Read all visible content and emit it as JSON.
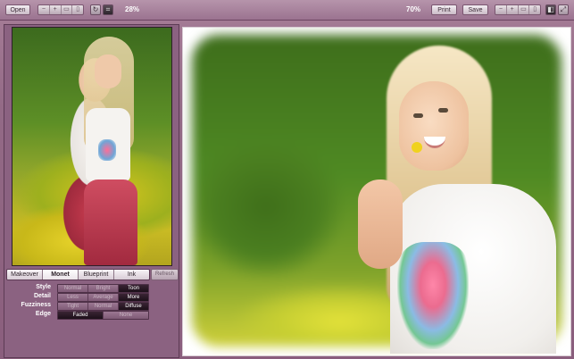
{
  "toolbar": {
    "open_label": "Open",
    "left_zoom_value": "28%",
    "right_zoom_value": "70%",
    "print_label": "Print",
    "save_label": "Save"
  },
  "tabs": [
    {
      "label": "Makeover",
      "active": false
    },
    {
      "label": "Monet",
      "active": true
    },
    {
      "label": "Blueprint",
      "active": false
    },
    {
      "label": "Ink",
      "active": false
    }
  ],
  "refresh_label": "Refresh",
  "options": {
    "style": {
      "label": "Style",
      "choices": [
        "Normal",
        "Bright",
        "Toon"
      ],
      "selected": "Toon"
    },
    "detail": {
      "label": "Detail",
      "choices": [
        "Less",
        "Average",
        "More"
      ],
      "selected": "More"
    },
    "fuzziness": {
      "label": "Fuzziness",
      "choices": [
        "Tight",
        "Normal",
        "Diffuse"
      ],
      "selected": "Diffuse"
    },
    "edge": {
      "label": "Edge",
      "choices": [
        "Faded",
        "None"
      ],
      "selected": "Faded"
    }
  },
  "colors": {
    "chrome": "#936a86",
    "selected_option": "#1c1019",
    "canvas": "#ffffff"
  }
}
